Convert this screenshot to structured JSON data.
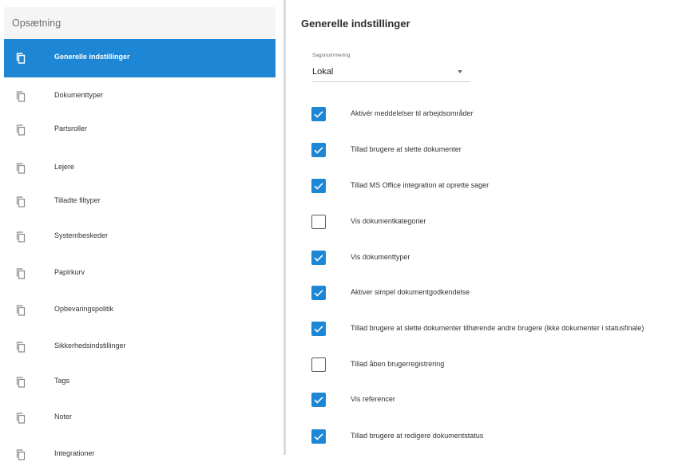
{
  "sidebar": {
    "header": "Opsætning",
    "items": [
      {
        "label": "Generelle indstillinger",
        "active": true
      },
      {
        "label": "Dokumenttyper",
        "active": false
      },
      {
        "label": "Partsroller",
        "active": false
      },
      {
        "label": "Lejere",
        "active": false
      },
      {
        "label": "Tilladte filtyper",
        "active": false
      },
      {
        "label": "Systembeskeder",
        "active": false
      },
      {
        "label": "Papirkurv",
        "active": false
      },
      {
        "label": "Opbevaringspolitik",
        "active": false
      },
      {
        "label": "Sikkerhedsindstillinger",
        "active": false
      },
      {
        "label": "Tags",
        "active": false
      },
      {
        "label": "Noter",
        "active": false
      },
      {
        "label": "Integrationer",
        "active": false
      }
    ],
    "item_icon": "copy-document-icon"
  },
  "main": {
    "title": "Generelle indstillinger",
    "select": {
      "label": "Sagsnummering",
      "value": "Lokal",
      "icon": "dropdown-arrow-icon"
    },
    "options": [
      {
        "label": "Aktivér meddelelser til arbejdsområder",
        "checked": true
      },
      {
        "label": "Tillad brugere at slette dokumenter",
        "checked": true
      },
      {
        "label": "Tillad MS Office integration at oprette sager",
        "checked": true
      },
      {
        "label": "Vis dokumentkategorier",
        "checked": false
      },
      {
        "label": "Vis dokumenttyper",
        "checked": true
      },
      {
        "label": "Aktiver simpel dokumentgodkendelse",
        "checked": true
      },
      {
        "label": "Tillad brugere at slette dokumenter tilhørende andre brugere (ikke dokumenter i statusfinale)",
        "checked": true
      },
      {
        "label": "Tillad åben brugerregistrering",
        "checked": false
      },
      {
        "label": "Vis referencer",
        "checked": true
      },
      {
        "label": "Tillad brugere at redigere dokumentstatus",
        "checked": true
      }
    ]
  },
  "colors": {
    "accent": "#1d87d6",
    "header_bg": "#f5f5f5",
    "divider": "#dcdcdc"
  }
}
